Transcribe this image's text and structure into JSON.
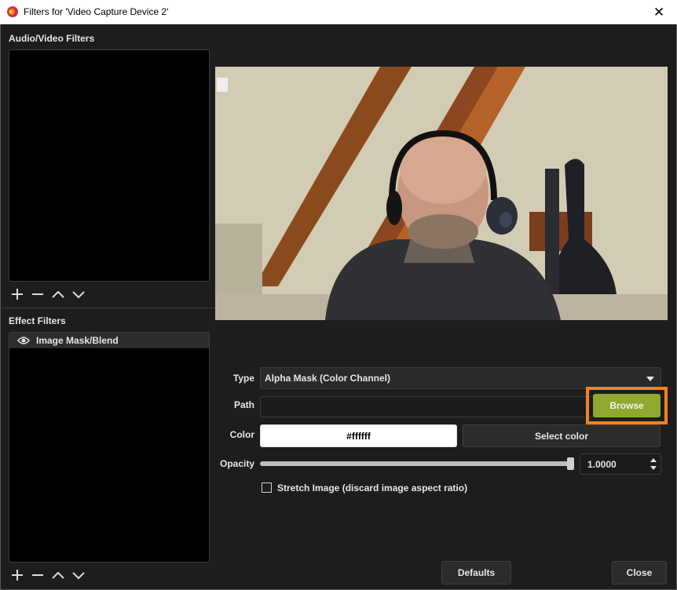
{
  "window": {
    "title": "Filters for 'Video Capture Device 2'"
  },
  "left": {
    "av_label": "Audio/Video Filters",
    "effect_label": "Effect Filters",
    "effect_items": [
      {
        "name": "Image Mask/Blend"
      }
    ]
  },
  "form": {
    "type_label": "Type",
    "type_value": "Alpha Mask (Color Channel)",
    "path_label": "Path",
    "path_value": "",
    "browse_label": "Browse",
    "color_label": "Color",
    "color_value": "#ffffff",
    "select_color_label": "Select color",
    "opacity_label": "Opacity",
    "opacity_value": "1.0000",
    "opacity_level": 1.0,
    "stretch_label": "Stretch Image (discard image aspect ratio)",
    "stretch_checked": false
  },
  "footer": {
    "defaults_label": "Defaults",
    "close_label": "Close"
  },
  "colors": {
    "accent": "#8fa82e",
    "highlight": "#f7801d",
    "background": "#1d1d1d"
  }
}
